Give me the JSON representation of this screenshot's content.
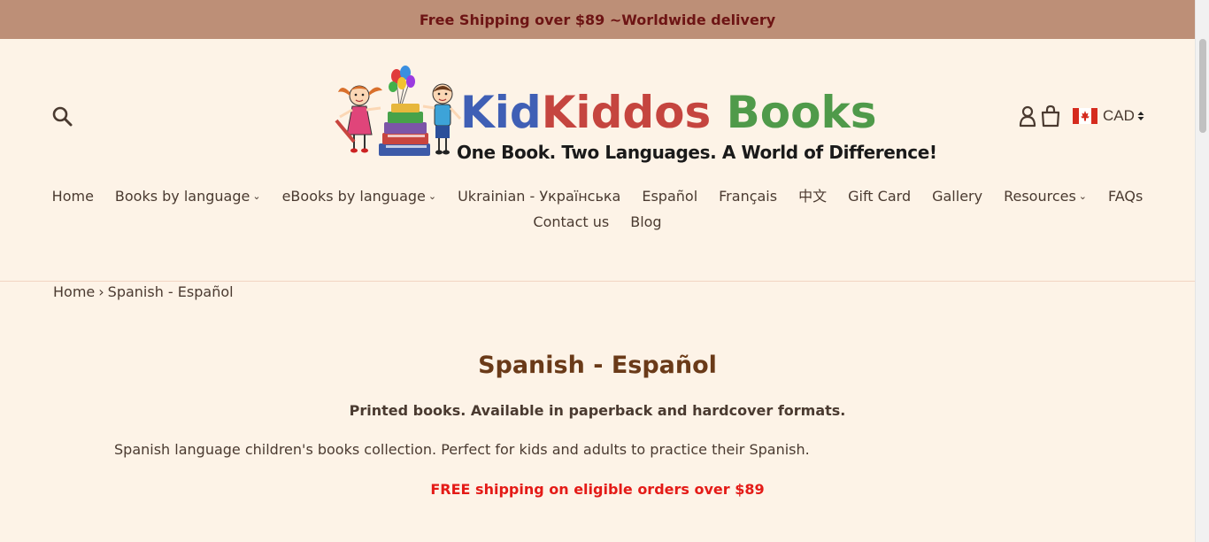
{
  "announcement": {
    "text": "Free Shipping over $89 ~Worldwide delivery"
  },
  "header": {
    "logo": {
      "word_kid": "Kid",
      "word_kiddos": "Kiddos",
      "word_books": " Books",
      "tagline": "One Book. Two Languages. A World of Difference!"
    },
    "currency": {
      "selected": "CAD"
    },
    "icons": [
      "search-icon",
      "account-icon",
      "cart-icon",
      "canada-flag-icon"
    ]
  },
  "nav": {
    "items": [
      {
        "label": "Home",
        "has_dropdown": false
      },
      {
        "label": "Books by language",
        "has_dropdown": true
      },
      {
        "label": "eBooks by language",
        "has_dropdown": true
      },
      {
        "label": "Ukrainian - Українська",
        "has_dropdown": false
      },
      {
        "label": "Español",
        "has_dropdown": false
      },
      {
        "label": "Français",
        "has_dropdown": false
      },
      {
        "label": "中文",
        "has_dropdown": false
      },
      {
        "label": "Gift Card",
        "has_dropdown": false
      },
      {
        "label": "Gallery",
        "has_dropdown": false
      },
      {
        "label": "Resources",
        "has_dropdown": true
      },
      {
        "label": "FAQs",
        "has_dropdown": false
      },
      {
        "label": "Contact us",
        "has_dropdown": false
      },
      {
        "label": "Blog",
        "has_dropdown": false
      }
    ],
    "chevron": "⌄"
  },
  "breadcrumb": {
    "home": "Home",
    "separator": "›",
    "current": "Spanish - Español"
  },
  "collection": {
    "title": "Spanish - Español",
    "subtitle": "Printed books. Available in paperback and hardcover formats.",
    "description": "Spanish language children's books collection. Perfect for kids and adults to practice their Spanish.",
    "promo": "FREE shipping on eligible orders over $89"
  },
  "colors": {
    "announcement_bg": "#bd8f77",
    "announcement_text": "#6d1414",
    "page_bg": "#fdf3e7",
    "title": "#6a3a18",
    "promo": "#e41b17"
  }
}
